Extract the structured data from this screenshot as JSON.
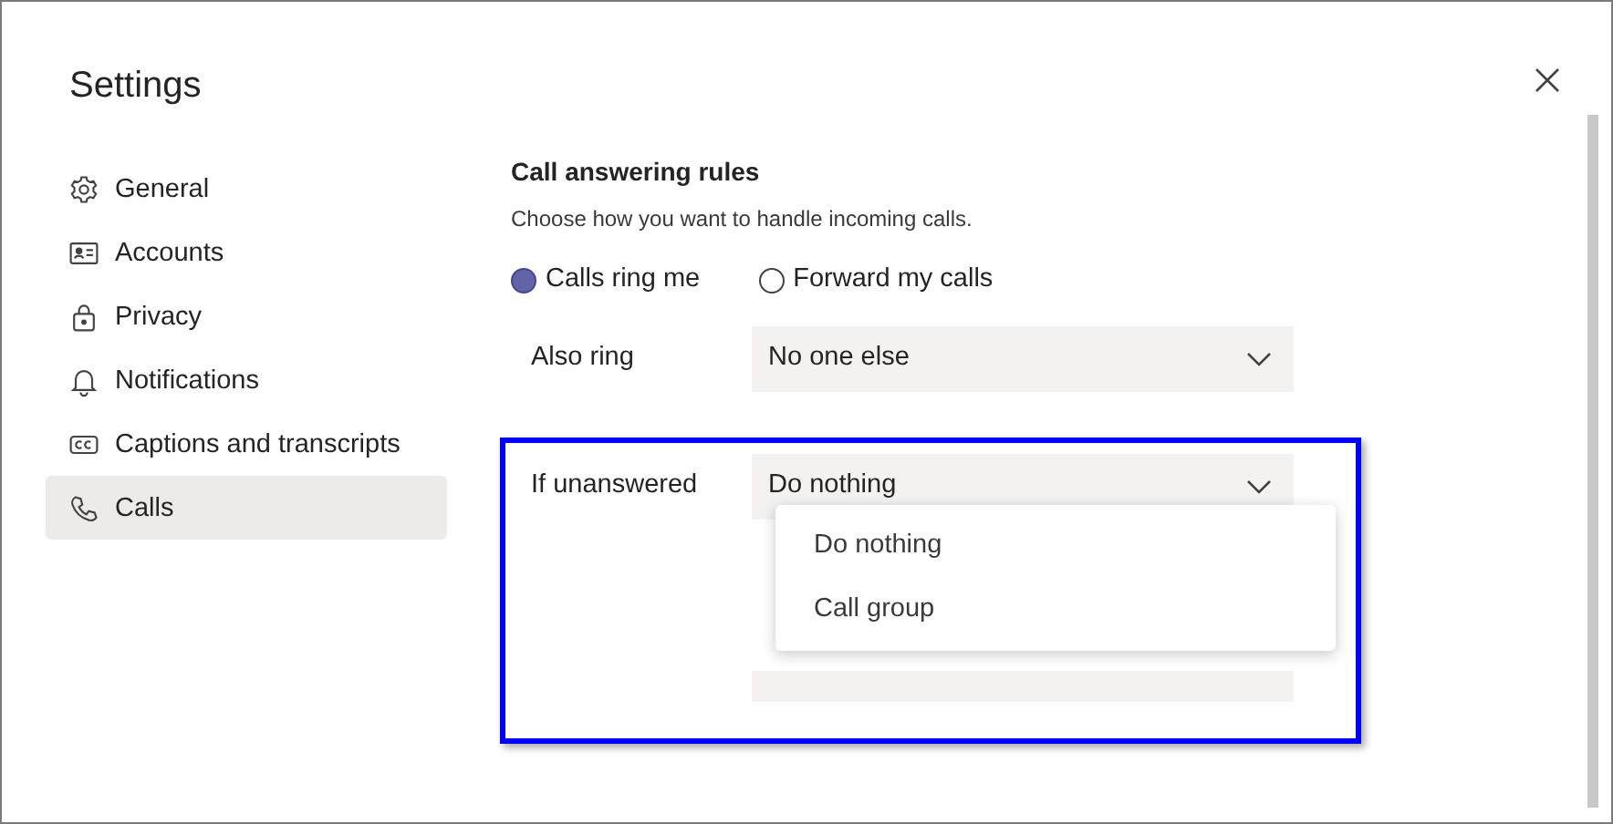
{
  "window": {
    "title": "Settings"
  },
  "sidebar": {
    "items": [
      {
        "label": "General",
        "selected": false
      },
      {
        "label": "Accounts",
        "selected": false
      },
      {
        "label": "Privacy",
        "selected": false
      },
      {
        "label": "Notifications",
        "selected": false
      },
      {
        "label": "Captions and transcripts",
        "selected": false
      },
      {
        "label": "Calls",
        "selected": true
      }
    ]
  },
  "section": {
    "title": "Call answering rules",
    "description": "Choose how you want to handle incoming calls.",
    "radios": [
      {
        "label": "Calls ring me",
        "selected": true
      },
      {
        "label": "Forward my calls",
        "selected": false
      }
    ],
    "also_ring": {
      "label": "Also ring",
      "value": "No one else"
    },
    "if_unanswered": {
      "label": "If unanswered",
      "value": "Do nothing",
      "expanded": true,
      "options": [
        "Do nothing",
        "Call group"
      ]
    }
  }
}
